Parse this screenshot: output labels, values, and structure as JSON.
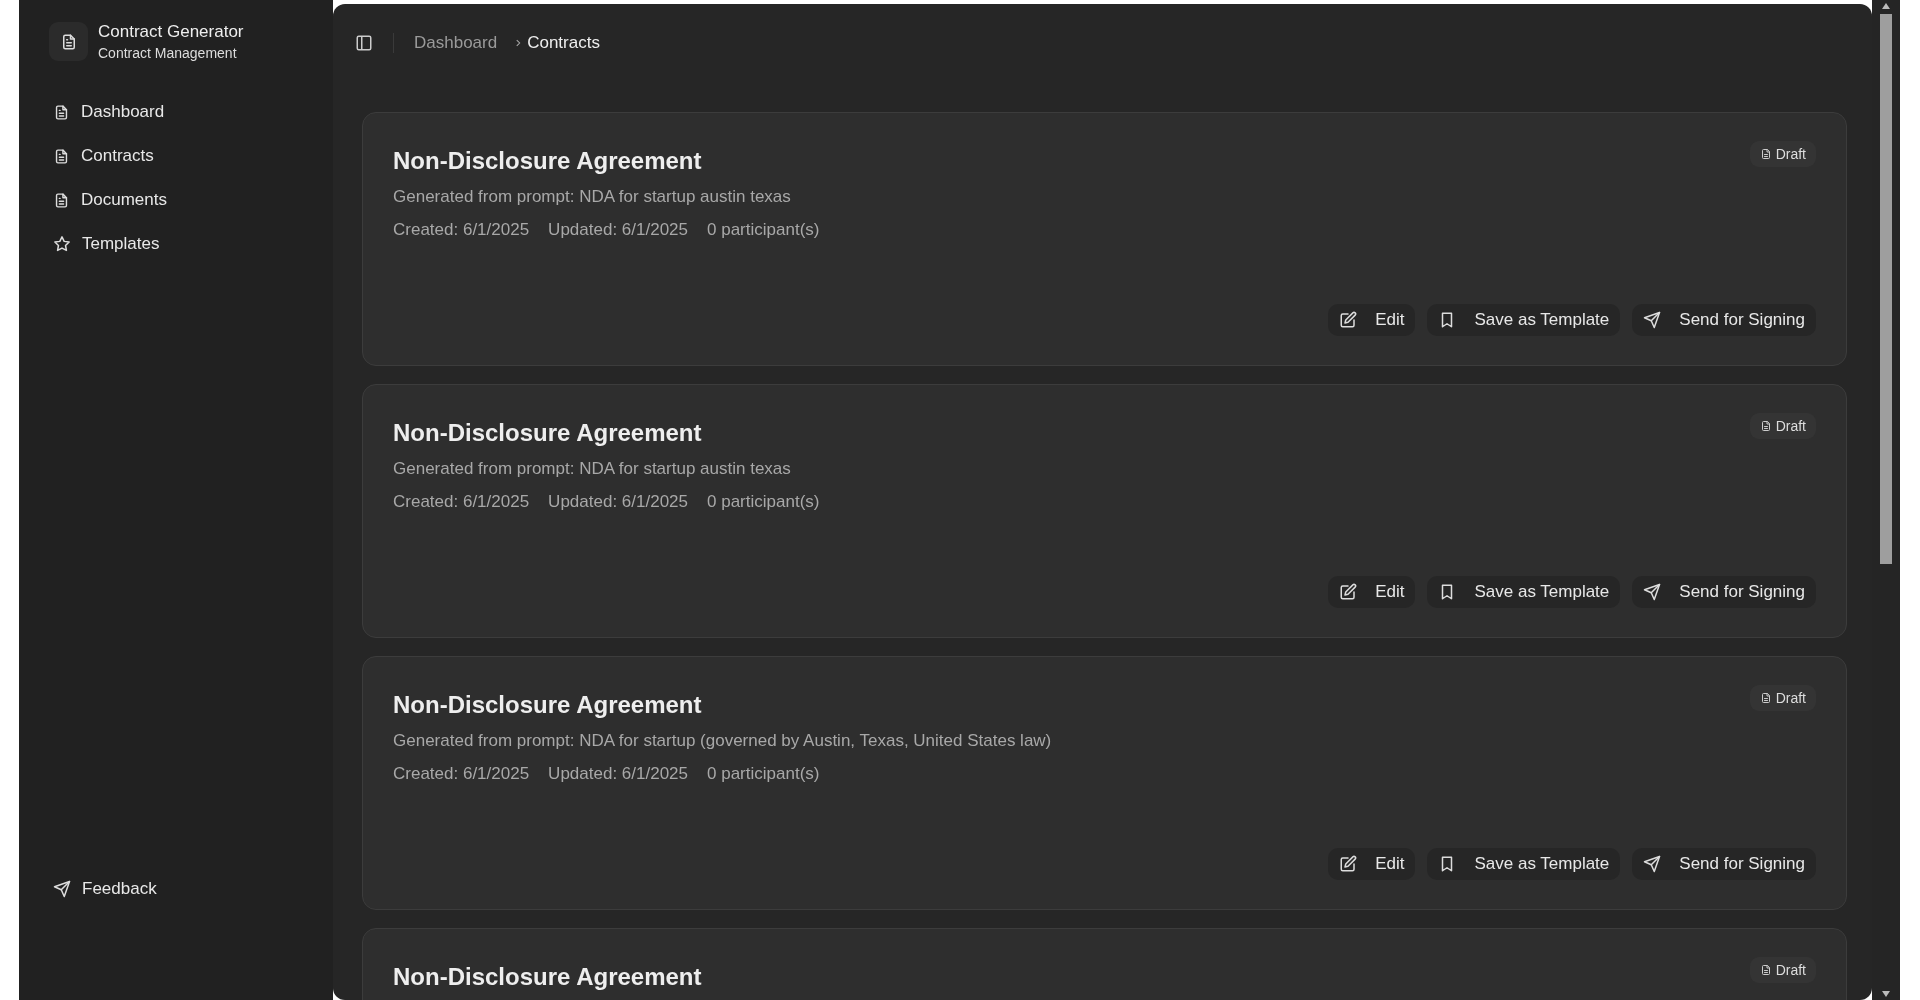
{
  "sidebar": {
    "app_title": "Contract Generator",
    "app_subtitle": "Contract Management",
    "items": [
      {
        "label": "Dashboard",
        "kind": "document"
      },
      {
        "label": "Contracts",
        "kind": "document"
      },
      {
        "label": "Documents",
        "kind": "document"
      },
      {
        "label": "Templates",
        "kind": "star"
      }
    ],
    "footer_item": {
      "label": "Feedback",
      "kind": "send"
    }
  },
  "breadcrumb": [
    {
      "label": "Dashboard",
      "current": false
    },
    {
      "label": "Contracts",
      "current": true
    }
  ],
  "contracts": [
    {
      "title": "Non-Disclosure Agreement",
      "status": "Draft",
      "description": "Generated from prompt: NDA for startup austin texas",
      "created": "Created: 6/1/2025",
      "updated": "Updated: 6/1/2025",
      "participants": "0 participant(s)",
      "actions": [
        {
          "label": "Edit",
          "kind": "edit"
        },
        {
          "label": "Save as Template",
          "kind": "save"
        },
        {
          "label": "Send for Signing",
          "kind": "send"
        }
      ]
    },
    {
      "title": "Non-Disclosure Agreement",
      "status": "Draft",
      "description": "Generated from prompt: NDA for startup austin texas",
      "created": "Created: 6/1/2025",
      "updated": "Updated: 6/1/2025",
      "participants": "0 participant(s)",
      "actions": [
        {
          "label": "Edit",
          "kind": "edit"
        },
        {
          "label": "Save as Template",
          "kind": "save"
        },
        {
          "label": "Send for Signing",
          "kind": "send"
        }
      ]
    },
    {
      "title": "Non-Disclosure Agreement",
      "status": "Draft",
      "description": "Generated from prompt: NDA for startup (governed by Austin, Texas, United States law)",
      "created": "Created: 6/1/2025",
      "updated": "Updated: 6/1/2025",
      "participants": "0 participant(s)",
      "actions": [
        {
          "label": "Edit",
          "kind": "edit"
        },
        {
          "label": "Save as Template",
          "kind": "save"
        },
        {
          "label": "Send for Signing",
          "kind": "send"
        }
      ]
    },
    {
      "title": "Non-Disclosure Agreement",
      "status": "Draft"
    }
  ]
}
